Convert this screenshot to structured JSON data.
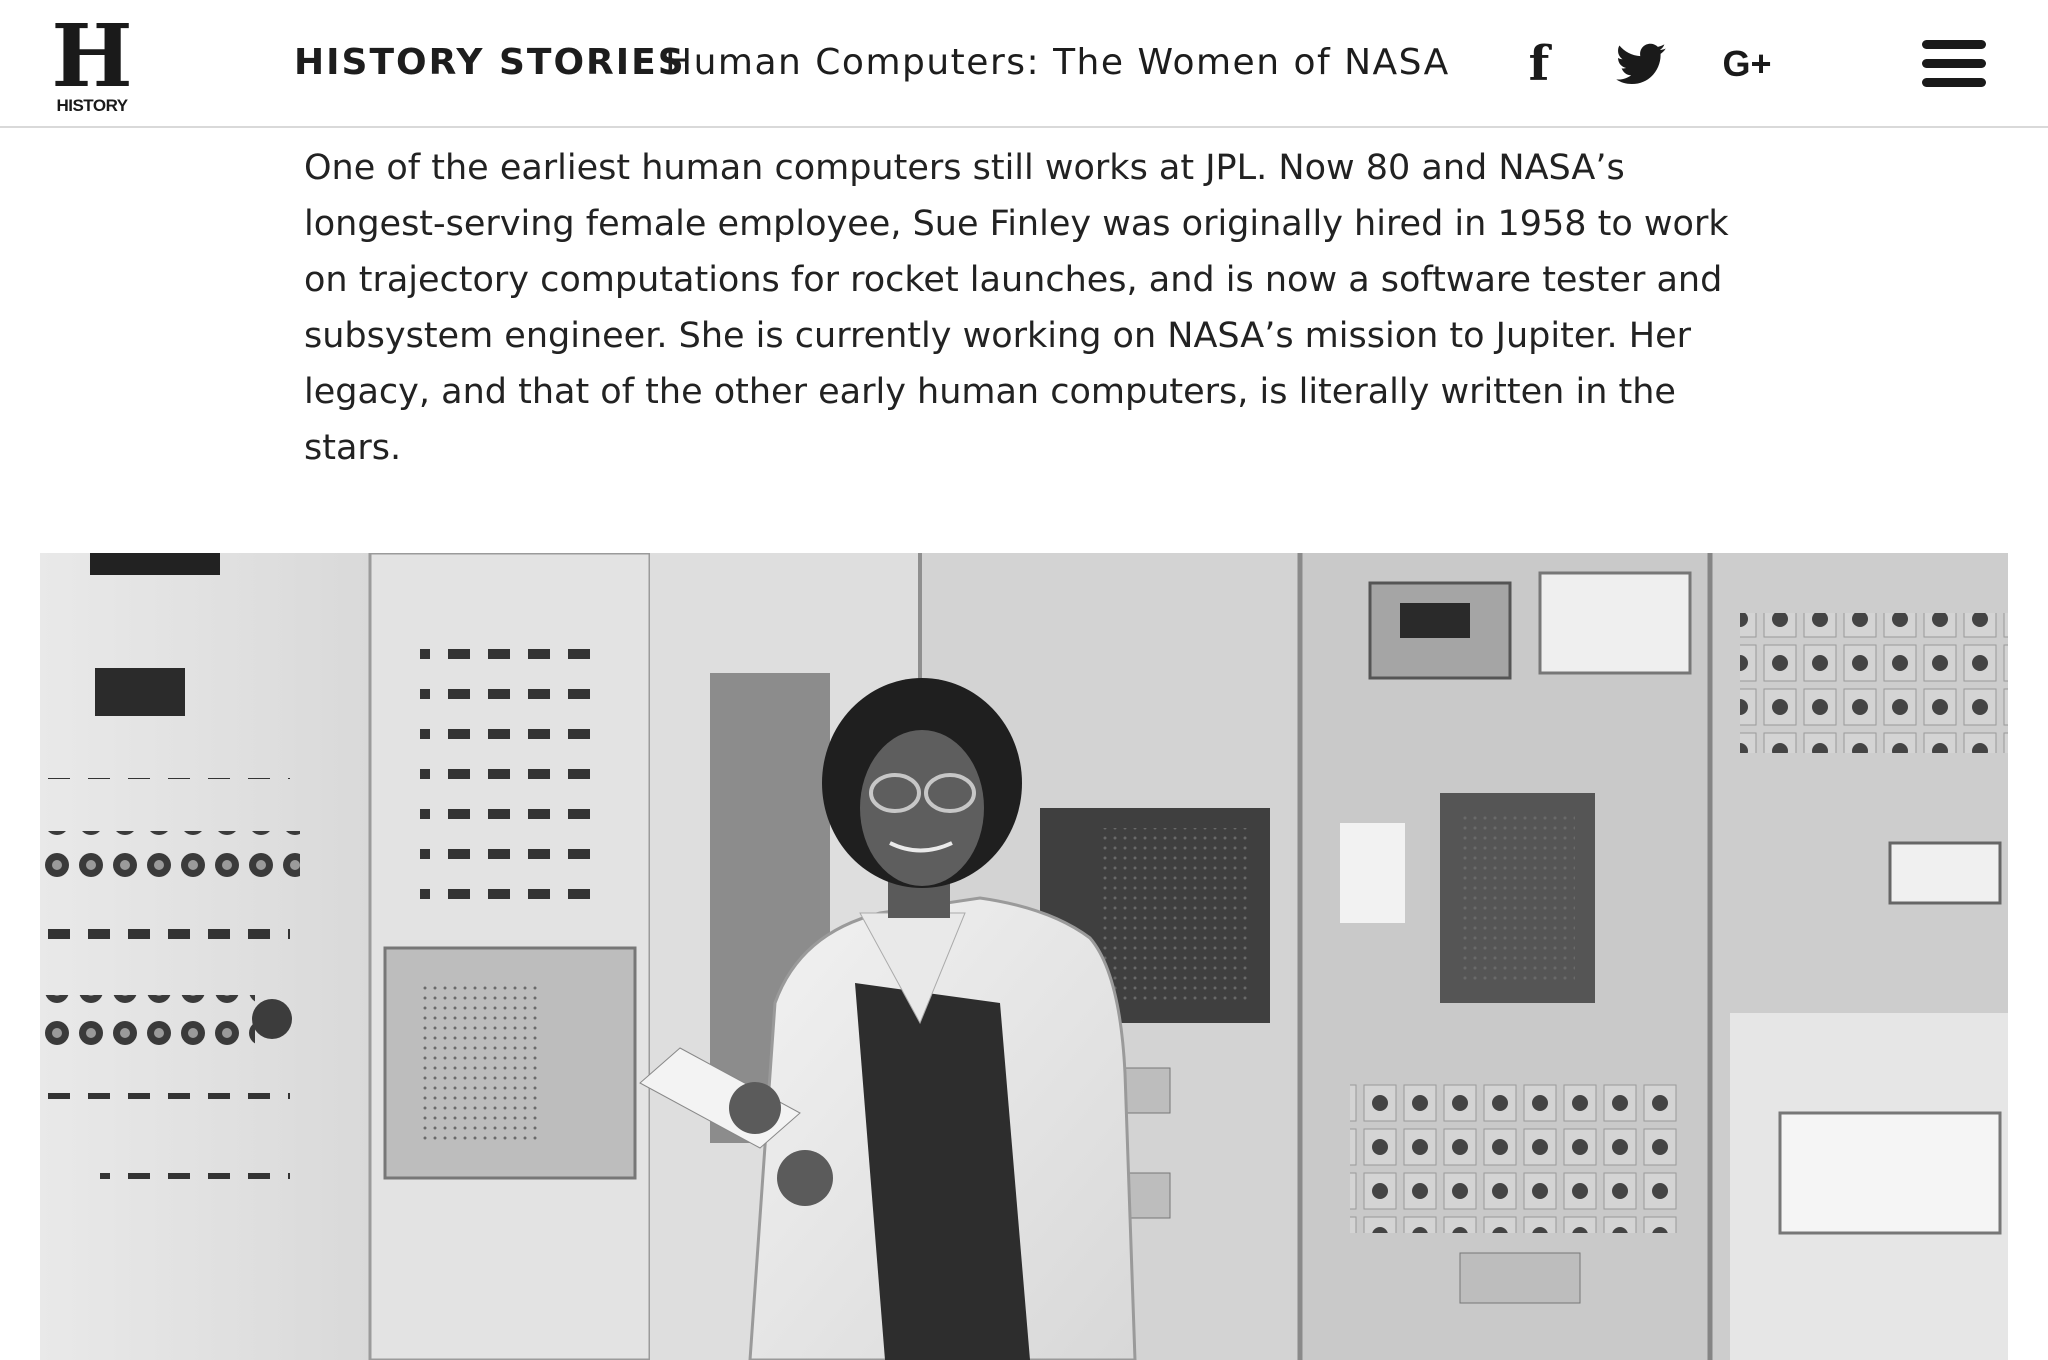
{
  "header": {
    "logo": {
      "symbol": "H",
      "wordmark": "HISTORY"
    },
    "section_label": "HISTORY STORIES",
    "article_title": "Human Computers: The Women of NASA",
    "social": [
      {
        "icon": "facebook-icon",
        "glyph": "f"
      },
      {
        "icon": "twitter-icon"
      },
      {
        "icon": "google-plus-icon",
        "glyph": "G+"
      }
    ],
    "menu_icon": "hamburger-menu-icon"
  },
  "article": {
    "paragraph": "One of the earliest human computers still works at JPL. Now 80 and NASA’s longest-serving female employee, Sue Finley was originally hired in 1958 to work on trajectory computations for rocket launches, and is now a software tester and subsystem engineer. She is currently working on NASA’s mission to Jupiter. Her legacy, and that of the other early human computers, is literally written in the stars."
  },
  "colors": {
    "text": "#222222",
    "header_border": "#d9d9d9",
    "icon": "#1a1a1a"
  }
}
